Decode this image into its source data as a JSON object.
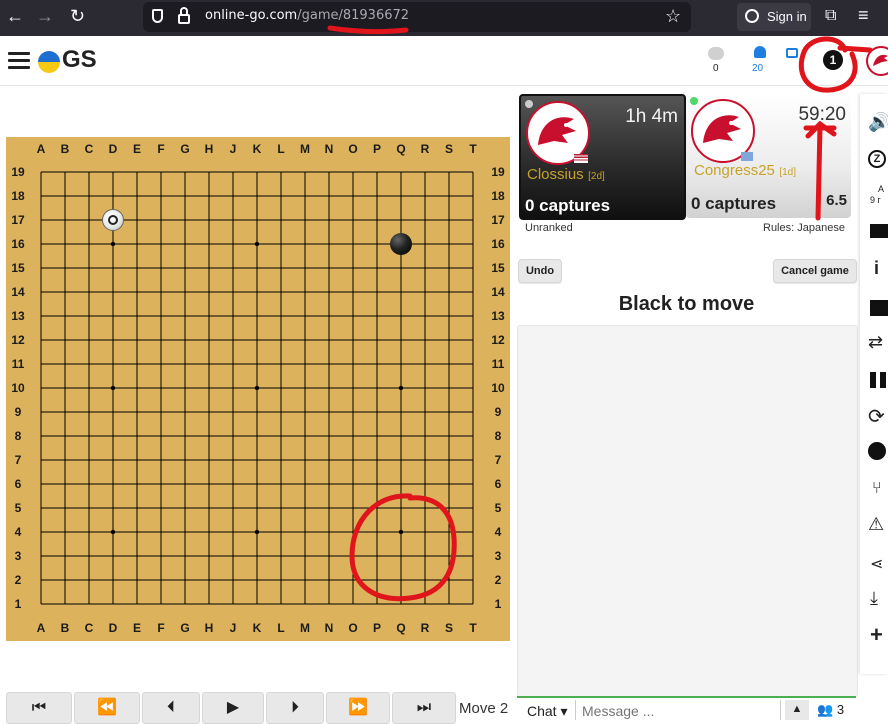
{
  "browser": {
    "url_host": "online-go.com",
    "url_path": "/game/",
    "url_id": "81936672",
    "signin_label": "Sign in"
  },
  "header": {
    "logo_text": "GS",
    "chat_count": "0",
    "notif_count": "20",
    "badge_count": "1"
  },
  "board": {
    "columns": [
      "A",
      "B",
      "C",
      "D",
      "E",
      "F",
      "G",
      "H",
      "J",
      "K",
      "L",
      "M",
      "N",
      "O",
      "P",
      "Q",
      "R",
      "S",
      "T"
    ],
    "rows": [
      "19",
      "18",
      "17",
      "16",
      "15",
      "14",
      "13",
      "12",
      "11",
      "10",
      "9",
      "8",
      "7",
      "6",
      "5",
      "4",
      "3",
      "2",
      "1"
    ],
    "stones": [
      {
        "point": "D17",
        "color": "white",
        "last_move": true
      },
      {
        "point": "Q16",
        "color": "black",
        "last_move": false
      }
    ]
  },
  "players": {
    "black": {
      "name": "Clossius",
      "rank": "[2d]",
      "clock": "1h 4m",
      "captures": "0 captures",
      "status": "Unranked"
    },
    "white": {
      "name": "Congress25",
      "rank": "[1d]",
      "clock": "59:20",
      "captures": "0 captures",
      "komi": "6.5",
      "rules": "Rules: Japanese"
    }
  },
  "actions": {
    "undo": "Undo",
    "cancel": "Cancel game"
  },
  "status": "Black to move",
  "playback": {
    "move_label": "Move 2"
  },
  "chat": {
    "channel": "Chat",
    "placeholder": "Message ...",
    "users": "3"
  },
  "colors": {
    "board": "#dcb35c",
    "accent_green": "#4caf50",
    "annotation_red": "#e0141b",
    "name_gold": "#c7a228"
  }
}
